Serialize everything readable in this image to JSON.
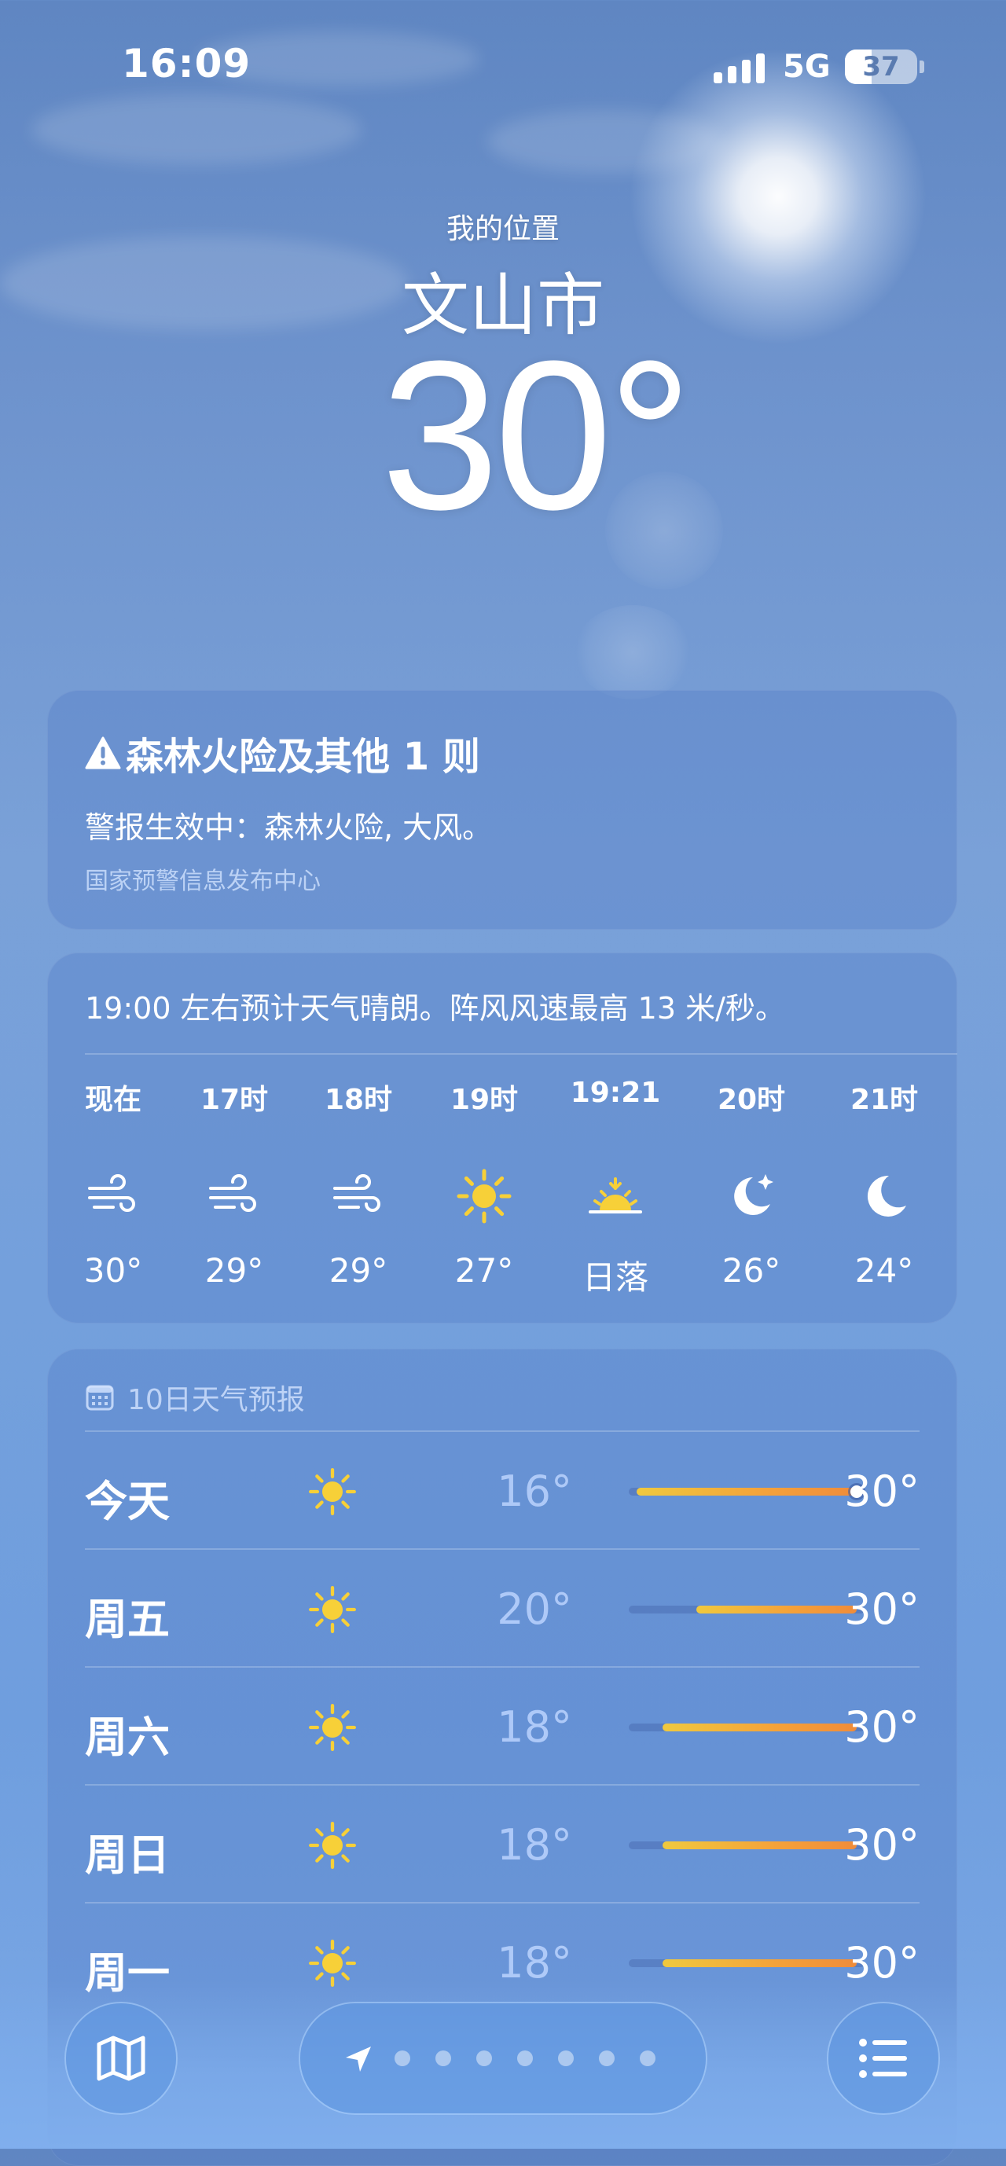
{
  "status_bar": {
    "time": "16:09",
    "network": "5G",
    "battery": "37",
    "battery_level": 0.37
  },
  "header": {
    "location_label": "我的位置",
    "city": "文山市",
    "temperature": "30°"
  },
  "alert": {
    "title": "森林火险及其他 1 则",
    "description": "警报生效中：森林火险, 大风。",
    "source": "国家预警信息发布中心",
    "icon": "warning-icon"
  },
  "hourly": {
    "summary": "19:00 左右预计天气晴朗。阵风风速最高 13 米/秒。",
    "items": [
      {
        "label": "现在",
        "icon": "wind-icon",
        "temp": "30°"
      },
      {
        "label": "17时",
        "icon": "wind-icon",
        "temp": "29°"
      },
      {
        "label": "18时",
        "icon": "wind-icon",
        "temp": "29°"
      },
      {
        "label": "19时",
        "icon": "sun-icon",
        "temp": "27°"
      },
      {
        "label": "19:21",
        "icon": "sunset-icon",
        "temp": "日落"
      },
      {
        "label": "20时",
        "icon": "moon-stars-icon",
        "temp": "26°"
      },
      {
        "label": "21时",
        "icon": "moon-icon",
        "temp": "24°"
      }
    ]
  },
  "daily": {
    "title": "10日天气预报",
    "range_min": 16,
    "range_max": 30,
    "current_temp": 30,
    "items": [
      {
        "day": "今天",
        "icon": "sun-icon",
        "low": "16°",
        "high": "30°",
        "low_value": 16,
        "high_value": 30
      },
      {
        "day": "周五",
        "icon": "sun-icon",
        "low": "20°",
        "high": "30°",
        "low_value": 20,
        "high_value": 30
      },
      {
        "day": "周六",
        "icon": "sun-icon",
        "low": "18°",
        "high": "30°",
        "low_value": 18,
        "high_value": 30
      },
      {
        "day": "周日",
        "icon": "sun-icon",
        "low": "18°",
        "high": "30°",
        "low_value": 18,
        "high_value": 30
      },
      {
        "day": "周一",
        "icon": "sun-icon",
        "low": "18°",
        "high": "30°",
        "low_value": 18,
        "high_value": 30
      }
    ]
  },
  "bottom_bar": {
    "map_icon": "map-icon",
    "list_icon": "list-icon",
    "location_icon": "location-arrow-icon",
    "page_count": 8,
    "active_page": 0
  },
  "colors": {
    "sky_top": "#5f86c2",
    "sky_bottom": "#7ba8e6",
    "temp_bar_start": "#f0c93e",
    "temp_bar_end": "#f08c3a",
    "sun_icon": "#f7d038"
  }
}
